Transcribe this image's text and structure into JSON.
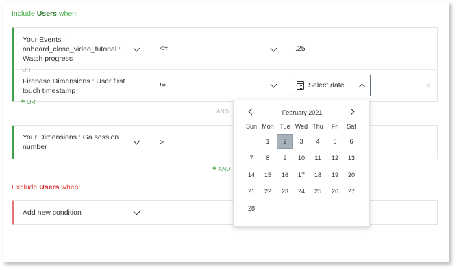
{
  "include_section": {
    "prefix": "Include ",
    "entity": "Users",
    "suffix": " when:"
  },
  "exclude_section": {
    "prefix": "Exclude ",
    "entity": "Users",
    "suffix": " when:"
  },
  "group1": {
    "rows": [
      {
        "field": "Your Events : onboard_close_video_tutorial : Watch progress",
        "operator": "<=",
        "value": ".25"
      },
      {
        "field": "Firebase Dimensions : User first touch timestamp",
        "operator": "!=",
        "value_placeholder": "Select date"
      }
    ],
    "or_label": "OR",
    "add_or_label": "OR"
  },
  "and_label": "AND",
  "group2": {
    "rows": [
      {
        "field": "Your Dimensions : Ga session number",
        "operator": ">"
      }
    ]
  },
  "add_and_label": "AND",
  "group3": {
    "placeholder": "Add new condition"
  },
  "datepicker": {
    "month": "February 2021",
    "weekdays": [
      "Sun",
      "Mon",
      "Tue",
      "Wed",
      "Thu",
      "Fri",
      "Sat"
    ],
    "weeks": [
      [
        "",
        "1",
        "2",
        "3",
        "4",
        "5",
        "6"
      ],
      [
        "7",
        "8",
        "9",
        "10",
        "11",
        "12",
        "13"
      ],
      [
        "14",
        "15",
        "16",
        "17",
        "18",
        "19",
        "20"
      ],
      [
        "21",
        "22",
        "23",
        "24",
        "25",
        "26",
        "27"
      ],
      [
        "28",
        "",
        "",
        "",
        "",
        "",
        ""
      ]
    ],
    "selected": "2"
  },
  "icons": {
    "remove": "×",
    "prev": "chevron-left-icon",
    "next": "chevron-right-icon",
    "calendar": "calendar-icon"
  }
}
